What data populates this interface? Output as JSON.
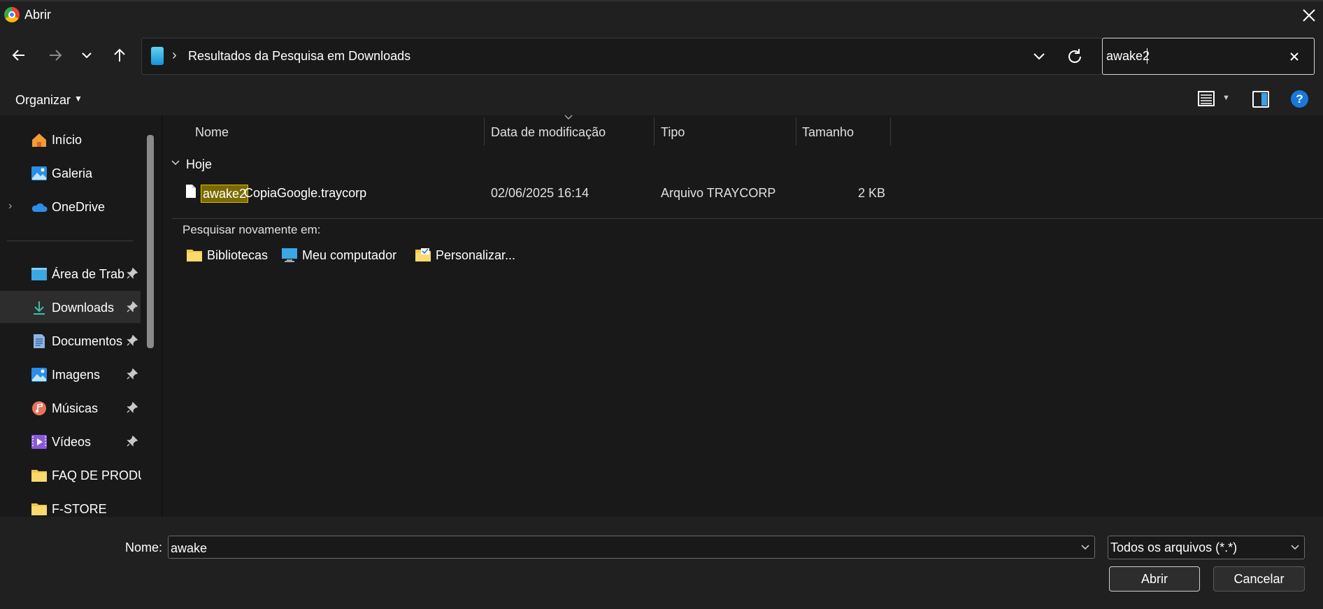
{
  "window": {
    "title": "Abrir"
  },
  "address": {
    "location": "Resultados da Pesquisa em Downloads"
  },
  "search": {
    "value": "awake2"
  },
  "toolbar": {
    "organize": "Organizar"
  },
  "sidebar": {
    "items": [
      {
        "label": "Início",
        "icon": "home-icon"
      },
      {
        "label": "Galeria",
        "icon": "gallery-icon"
      },
      {
        "label": "OneDrive",
        "icon": "cloud-icon"
      },
      {
        "label": "Área de Traba",
        "icon": "desktop-icon"
      },
      {
        "label": "Downloads",
        "icon": "download-icon"
      },
      {
        "label": "Documentos",
        "icon": "document-icon"
      },
      {
        "label": "Imagens",
        "icon": "image-icon"
      },
      {
        "label": "Músicas",
        "icon": "music-icon"
      },
      {
        "label": "Vídeos",
        "icon": "video-icon"
      },
      {
        "label": "FAQ DE PRODU",
        "icon": "folder-icon"
      },
      {
        "label": "F-STORE",
        "icon": "folder-icon"
      }
    ]
  },
  "columns": {
    "name": "Nome",
    "date": "Data de modificação",
    "type": "Tipo",
    "size": "Tamanho"
  },
  "group": {
    "label": "Hoje"
  },
  "file": {
    "match": "awake2",
    "rest": "CopiaGoogle.traycorp",
    "date": "02/06/2025 16:14",
    "type": "Arquivo TRAYCORP",
    "size": "2 KB"
  },
  "search_again": {
    "title": "Pesquisar novamente em:",
    "items": [
      "Bibliotecas",
      "Meu computador",
      "Personalizar..."
    ]
  },
  "bottom": {
    "name_label": "Nome:",
    "name_value": "awake",
    "file_type": "Todos os arquivos (*.*)",
    "open": "Abrir",
    "cancel": "Cancelar"
  },
  "colors": {
    "highlight": "#7a6a00",
    "accent": "#1a78d8",
    "background": "#191919"
  }
}
